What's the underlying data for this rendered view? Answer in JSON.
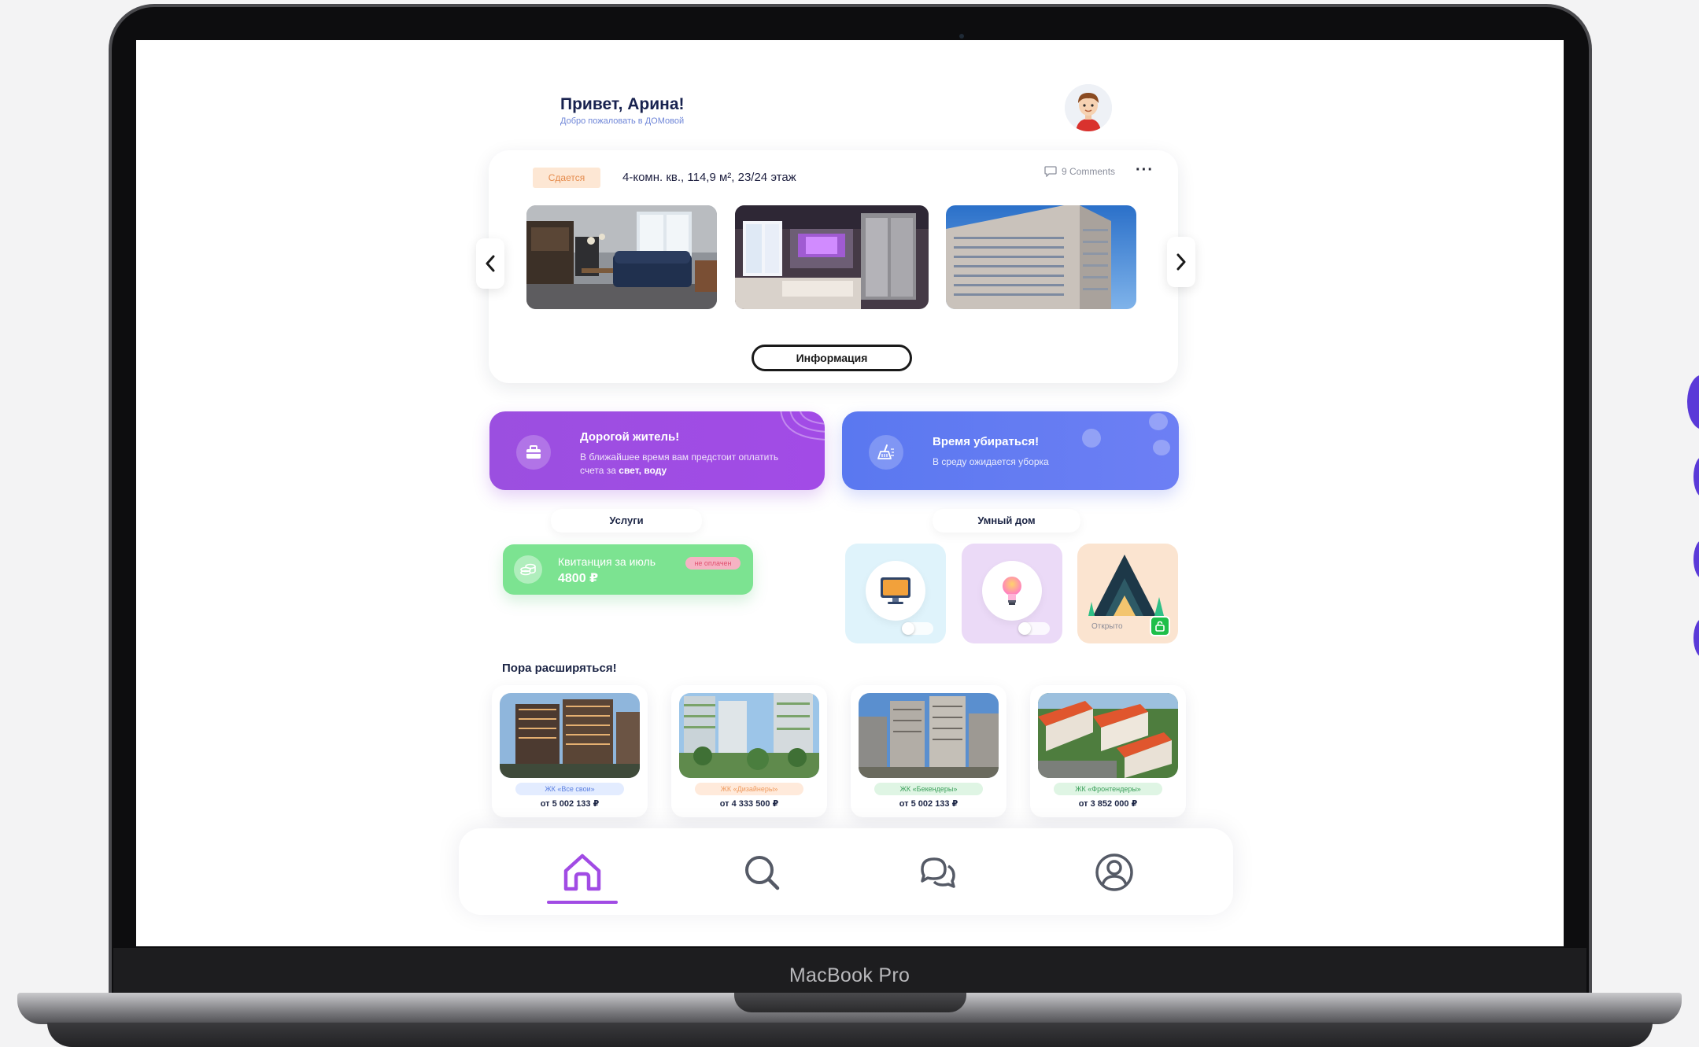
{
  "device": {
    "brand_label": "MacBook Pro"
  },
  "header": {
    "title": "Привет, Арина!",
    "subtitle": "Добро пожаловать в ДОМовой"
  },
  "listing": {
    "status_badge": "Сдается",
    "title": "4-комн. кв., 114,9 м², 23/24 этаж",
    "comments": "9 Comments",
    "more": "···",
    "info_button": "Информация",
    "photos": [
      "living-room-photo",
      "kitchen-photo",
      "building-photo"
    ]
  },
  "banners": {
    "resident": {
      "title": "Дорогой житель!",
      "text_line1": "В ближайшее время вам предстоит оплатить",
      "text_line2_prefix": "счета за ",
      "text_line2_bold": "свет, воду"
    },
    "cleaning": {
      "title": "Время убираться!",
      "text": "В среду ожидается уборка"
    }
  },
  "services": {
    "label": "Услуги",
    "receipt": {
      "title": "Квитанция за июль",
      "amount": "4800 ₽",
      "status": "не оплачен"
    }
  },
  "smart_home": {
    "label": "Умный дом",
    "tiles": [
      {
        "name": "tv",
        "color": "#dff3fb"
      },
      {
        "name": "lamp",
        "color": "#ebdaf7"
      },
      {
        "name": "house",
        "color": "#fbe4d0",
        "status": "Открыто"
      }
    ]
  },
  "expand": {
    "title": "Пора расширяться!",
    "complexes": [
      {
        "name": "ЖК «Все свои»",
        "price": "от 5 002 133 ₽",
        "tag_color": "#e3ecff",
        "tag_text_color": "#5b7fe0"
      },
      {
        "name": "ЖК «Дизайнеры»",
        "price": "от 4 333 500 ₽",
        "tag_color": "#ffeadb",
        "tag_text_color": "#ef9a5e"
      },
      {
        "name": "ЖК «Бекендеры»",
        "price": "от 5 002 133 ₽",
        "tag_color": "#dff5e4",
        "tag_text_color": "#3b9f5a"
      },
      {
        "name": "ЖК «Фронтендеры»",
        "price": "от 3 852 000 ₽",
        "tag_color": "#dff5e4",
        "tag_text_color": "#3b9f5a"
      }
    ]
  },
  "nav": {
    "items": [
      "home-icon",
      "search-icon",
      "chat-icon",
      "profile-icon"
    ],
    "active": 0,
    "accent": "#a14be4"
  }
}
